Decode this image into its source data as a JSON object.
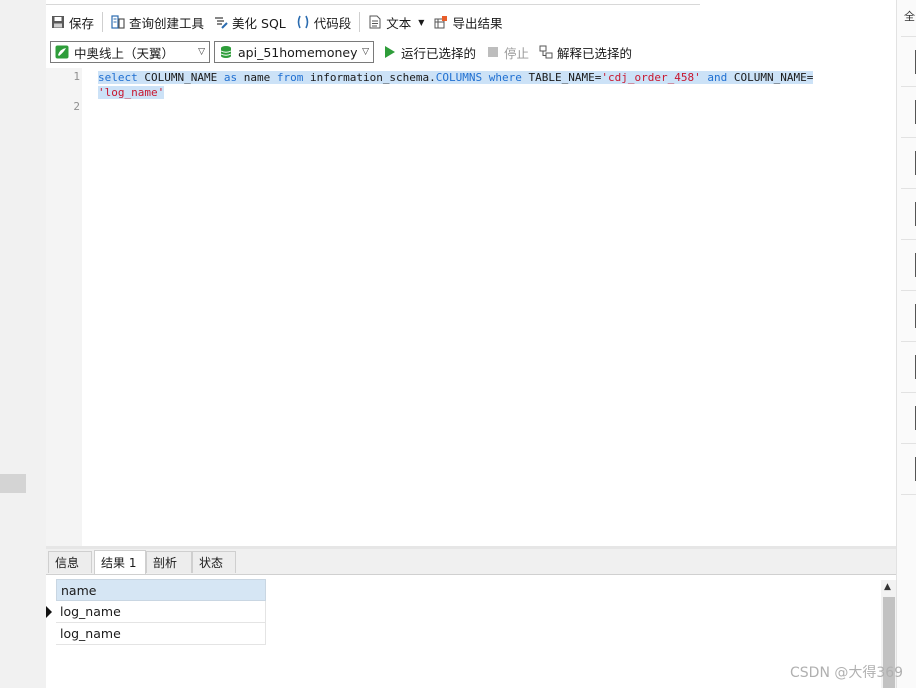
{
  "toolbar": {
    "save_label": "保存",
    "query_builder_label": "查询创建工具",
    "beautify_label": "美化 SQL",
    "snippet_label": "代码段",
    "text_label": "文本",
    "export_label": "导出结果"
  },
  "toolbar2": {
    "connection": "中奥线上（天翼）",
    "database": "api_51homemoney_",
    "run_selected_label": "运行已选择的",
    "stop_label": "停止",
    "explain_label": "解释已选择的"
  },
  "editor": {
    "line_numbers": [
      "1",
      "2"
    ],
    "tokens": {
      "select": "select",
      "col1": " COLUMN_NAME ",
      "as": "as",
      "name_kw": " name ",
      "from": "from",
      "schema": " information_schema.",
      "columns": "COLUMNS",
      "where": " where",
      "tbl": " TABLE_NAME=",
      "tblval": "'cdj_order_458'",
      "and": " and",
      "col2": " COLUMN_NAME=",
      "colval": "'log_name'"
    }
  },
  "result_tabs": [
    "信息",
    "结果 1",
    "剖析",
    "状态"
  ],
  "grid": {
    "header": "name",
    "rows": [
      "log_name",
      "log_name"
    ]
  },
  "right_panel_fragment": "全",
  "watermark": "CSDN @大得369",
  "colors": {
    "selection": "#cce2f7",
    "keyword": "#1f6fd1",
    "string": "#c8172f",
    "grid_header": "#d6e6f4",
    "run_green": "#2e9d3a"
  }
}
